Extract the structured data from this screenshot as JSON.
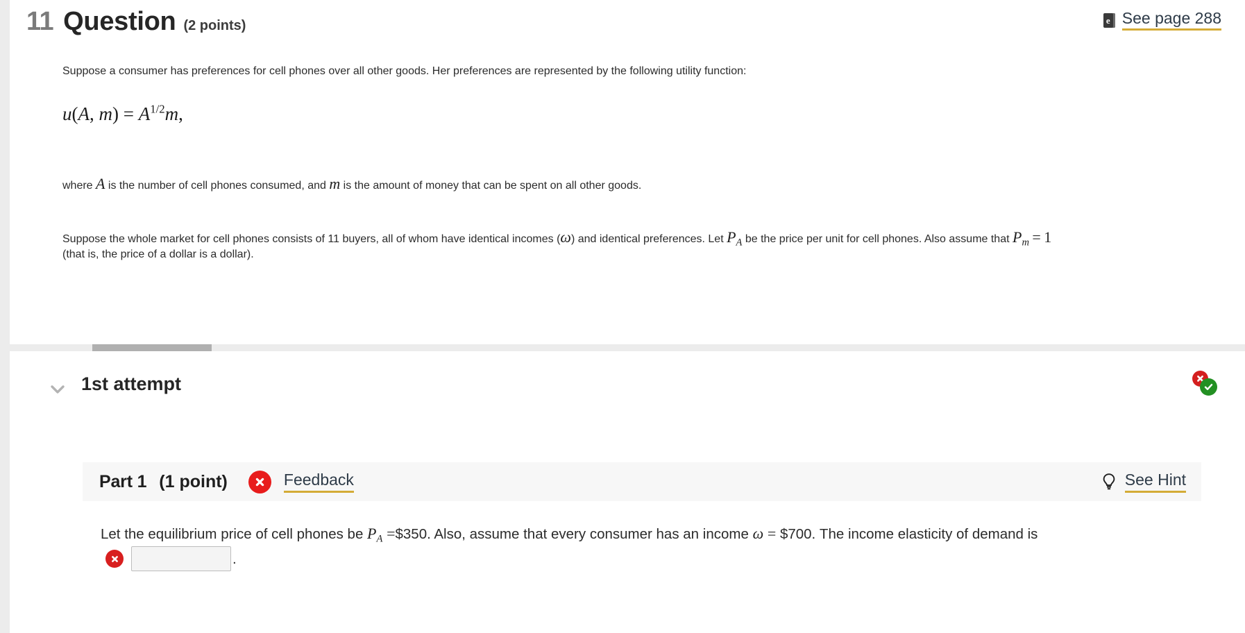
{
  "header": {
    "question_number": "11",
    "question_word": "Question",
    "points": "(2 points)",
    "see_page_label": "See page 288",
    "ebook_icon": "ebook-icon"
  },
  "question": {
    "intro": "Suppose a consumer has preferences for cell phones over all other goods. Her preferences are represented by the following utility function:",
    "formula": "u (A, m) = A^(1/2) m,",
    "formula_parts": {
      "u": "u",
      "open_paren": "(",
      "A": "A",
      "comma": ",",
      "m": "m",
      "close_paren": ")",
      "equals": "=",
      "A2": "A",
      "exponent": "1/2",
      "m2": "m",
      "trailing_comma": ","
    },
    "where_prefix": "where ",
    "where_var_A": "A",
    "where_mid": " is the number of cell phones consumed, and ",
    "where_var_m": "m",
    "where_suffix": " is the amount of money that can be spent on all other goods.",
    "market_line1_a": "Suppose the whole market for cell phones consists of 11 buyers, all of whom have identical incomes (",
    "market_omega": "ω",
    "market_line1_b": ") and identical preferences. Let ",
    "market_P": "P",
    "market_P_sub": "A",
    "market_line1_c": " be the price",
    "market_line2_a": "per unit for cell phones. Also assume that ",
    "market_Pm": "P",
    "market_Pm_sub": "m",
    "market_eq": "=",
    "market_one": "1",
    "market_line2_b": " (that is, the price of a dollar is a dollar)."
  },
  "attempt": {
    "label": "1st attempt",
    "chevron_icon": "chevron-down-icon",
    "progress_percent": 11,
    "badge_incorrect_icon": "x-circle-icon",
    "badge_correct_icon": "check-circle-icon"
  },
  "part": {
    "title": "Part 1",
    "points": "(1 point)",
    "status_icon": "x-circle-icon",
    "feedback_label": "Feedback",
    "hint_icon": "lightbulb-icon",
    "hint_label": "See Hint",
    "body_a": "Let the equilibrium price of cell phones be ",
    "body_P": "P",
    "body_P_sub": "A",
    "body_eq": "=",
    "body_price": "$350. Also, assume that every consumer has an income ",
    "body_omega": "ω",
    "body_eq2": "=",
    "body_income": "$700. The income elasticity of demand is",
    "answer_value": "",
    "answer_placeholder": "",
    "answer_status_icon": "x-circle-icon",
    "period": "."
  },
  "colors": {
    "accent_underline": "#d4ab36",
    "error_red": "#e81c1c",
    "success_green": "#239023",
    "link_text": "#2e3b48",
    "progress_fill": "#b0b0b0",
    "progress_track": "#ececec",
    "part_bar_bg": "#f7f7f7"
  }
}
